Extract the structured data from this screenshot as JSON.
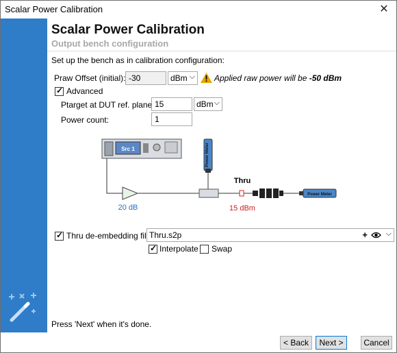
{
  "window": {
    "title": "Scalar Power Calibration",
    "close_glyph": "✕"
  },
  "header": {
    "title": "Scalar Power Calibration",
    "subtitle": "Output bench configuration"
  },
  "instruction": "Set up the bench as in calibration configuration:",
  "praw": {
    "label": "Praw Offset (initial):",
    "value": "-30",
    "unit": "dBm"
  },
  "warning": {
    "text": "Applied raw power will be ",
    "value": "-50 dBm",
    "icon": "warning-icon"
  },
  "advanced": {
    "label": "Advanced",
    "checked": true
  },
  "ptarget": {
    "label": "Ptarget at DUT ref. plane:",
    "value": "15",
    "unit": "dBm"
  },
  "power_count": {
    "label": "Power count:",
    "value": "1"
  },
  "diagram": {
    "source_label": "Src 1",
    "power_meter_label": "Power Meter",
    "amp_gain": "20 dB",
    "thru_label": "Thru",
    "thru_power": "15 dBm"
  },
  "thru_file": {
    "label": "Thru de-embedding file:",
    "checked": true,
    "value": "Thru.s2p",
    "add_glyph": "+",
    "view_icon": "eye-icon"
  },
  "interpolate": {
    "label": "Interpolate",
    "checked": true
  },
  "swap": {
    "label": "Swap",
    "checked": false
  },
  "footer_text": "Press 'Next' when it's done.",
  "buttons": {
    "back": "< Back",
    "next": "Next >",
    "cancel": "Cancel"
  },
  "colors": {
    "sidebar": "#2f7cc8",
    "gain_text": "#1f6fc4",
    "power_text": "#d02020",
    "warning": "#e8a400"
  }
}
